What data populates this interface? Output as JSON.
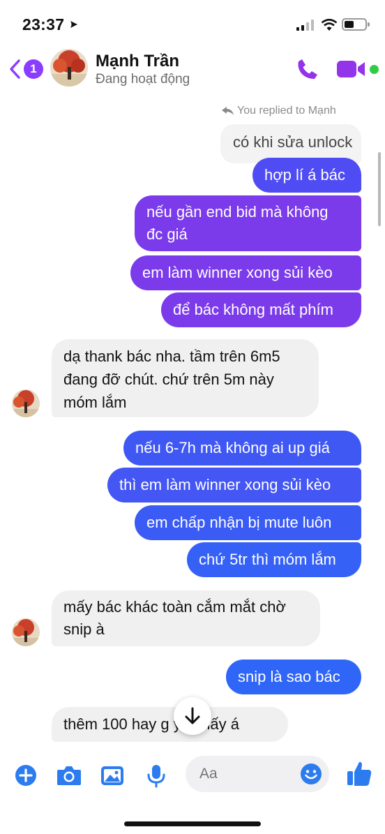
{
  "status": {
    "time": "23:37"
  },
  "header": {
    "back_badge": "1",
    "name": "Mạnh Trần",
    "subtitle": "Đang hoạt động"
  },
  "thread": {
    "reply_note": "You replied to Mạnh",
    "messages": [
      {
        "side": "in-quote",
        "text": "có khi sửa unlock"
      },
      {
        "side": "out",
        "text": "hợp lí á bác"
      },
      {
        "side": "out",
        "lines": [
          "nếu gần end bid mà không",
          "đc giá"
        ]
      },
      {
        "side": "out",
        "text": "em làm winner xong sủi kèo"
      },
      {
        "side": "out",
        "text": "để bác không mất phím"
      },
      {
        "side": "in",
        "lines": [
          "dạ thank bác nha. tầm trên 6m5",
          "đang đỡ chút. chứ trên 5m này",
          "móm lắm"
        ]
      },
      {
        "side": "out",
        "text": "nếu 6-7h mà không ai up giá"
      },
      {
        "side": "out",
        "text": "thì em làm winner xong sủi kèo"
      },
      {
        "side": "out",
        "text": "em chấp nhận bị mute luôn"
      },
      {
        "side": "out",
        "text": "chứ 5tr thì móm lắm"
      },
      {
        "side": "in",
        "lines": [
          "mấy bác khác toàn cắm mắt chờ",
          "snip à"
        ]
      },
      {
        "side": "out",
        "text": "snip là sao bác"
      },
      {
        "side": "in",
        "text": "thêm 100 hay g   y để lấy á"
      }
    ]
  },
  "composer": {
    "placeholder": "Aa"
  },
  "icons": {
    "back": "chevron-left-icon",
    "call": "phone-icon",
    "video": "video-camera-icon",
    "add": "plus-circle-icon",
    "camera": "camera-icon",
    "gallery": "image-icon",
    "mic": "microphone-icon",
    "emoji": "smiley-icon",
    "like": "thumbs-up-icon",
    "jump": "arrow-down-icon"
  },
  "colors": {
    "accent": "#8b3dff",
    "outgoing_blue": "#2f6bff",
    "outgoing_violet": "#7b3bea",
    "incoming": "#f0f0f1",
    "online": "#31cc46",
    "composer_icon": "#2c7cf0"
  }
}
